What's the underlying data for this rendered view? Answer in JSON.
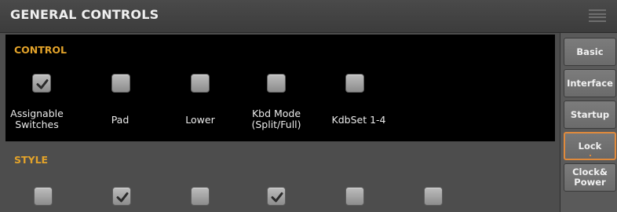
{
  "header": {
    "title": "GENERAL CONTROLS",
    "menu_icon": "menu-icon"
  },
  "control": {
    "title": "CONTROL",
    "items": [
      {
        "label": "Assignable\nSwitches",
        "checked": true
      },
      {
        "label": "Pad",
        "checked": false
      },
      {
        "label": "Lower",
        "checked": false
      },
      {
        "label": "Kbd Mode\n(Split/Full)",
        "checked": false
      },
      {
        "label": "KdbSet 1-4",
        "checked": false
      }
    ]
  },
  "style": {
    "title": "STYLE",
    "items": [
      {
        "checked": false
      },
      {
        "checked": true
      },
      {
        "checked": false
      },
      {
        "checked": true
      },
      {
        "checked": false
      },
      {
        "checked": false
      }
    ]
  },
  "tabs": [
    {
      "label": "Basic",
      "selected": false
    },
    {
      "label": "Interface",
      "selected": false
    },
    {
      "label": "Startup",
      "selected": false
    },
    {
      "label": "Lock",
      "selected": true
    },
    {
      "label": "Clock&\nPower",
      "selected": false
    }
  ],
  "colors": {
    "accent": "#e3a32a",
    "selected_tab_border": "#e08a3c"
  }
}
